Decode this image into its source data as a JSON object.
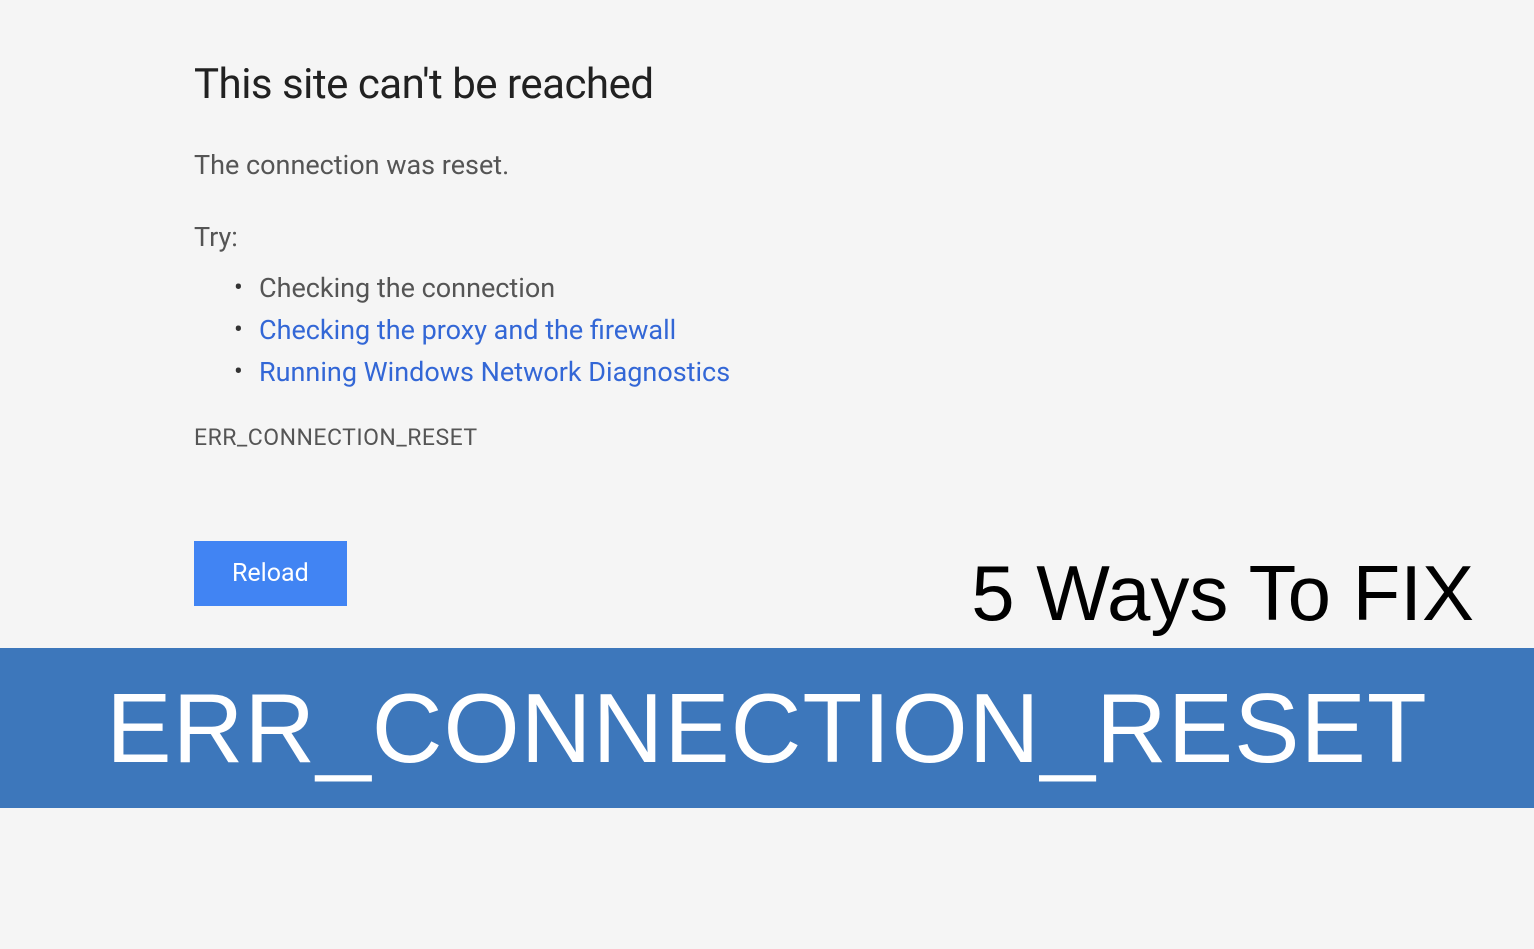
{
  "error": {
    "heading": "This site can't be reached",
    "subtext": "The connection was reset.",
    "try_label": "Try:",
    "suggestions": [
      {
        "text": "Checking the connection",
        "is_link": false
      },
      {
        "text": "Checking the proxy and the firewall",
        "is_link": true
      },
      {
        "text": "Running Windows Network Diagnostics",
        "is_link": true
      }
    ],
    "code": "ERR_CONNECTION_RESET",
    "reload_label": "Reload"
  },
  "overlay": {
    "title": "5 Ways To FIX",
    "banner_text": "ERR_CONNECTION_RESET"
  }
}
